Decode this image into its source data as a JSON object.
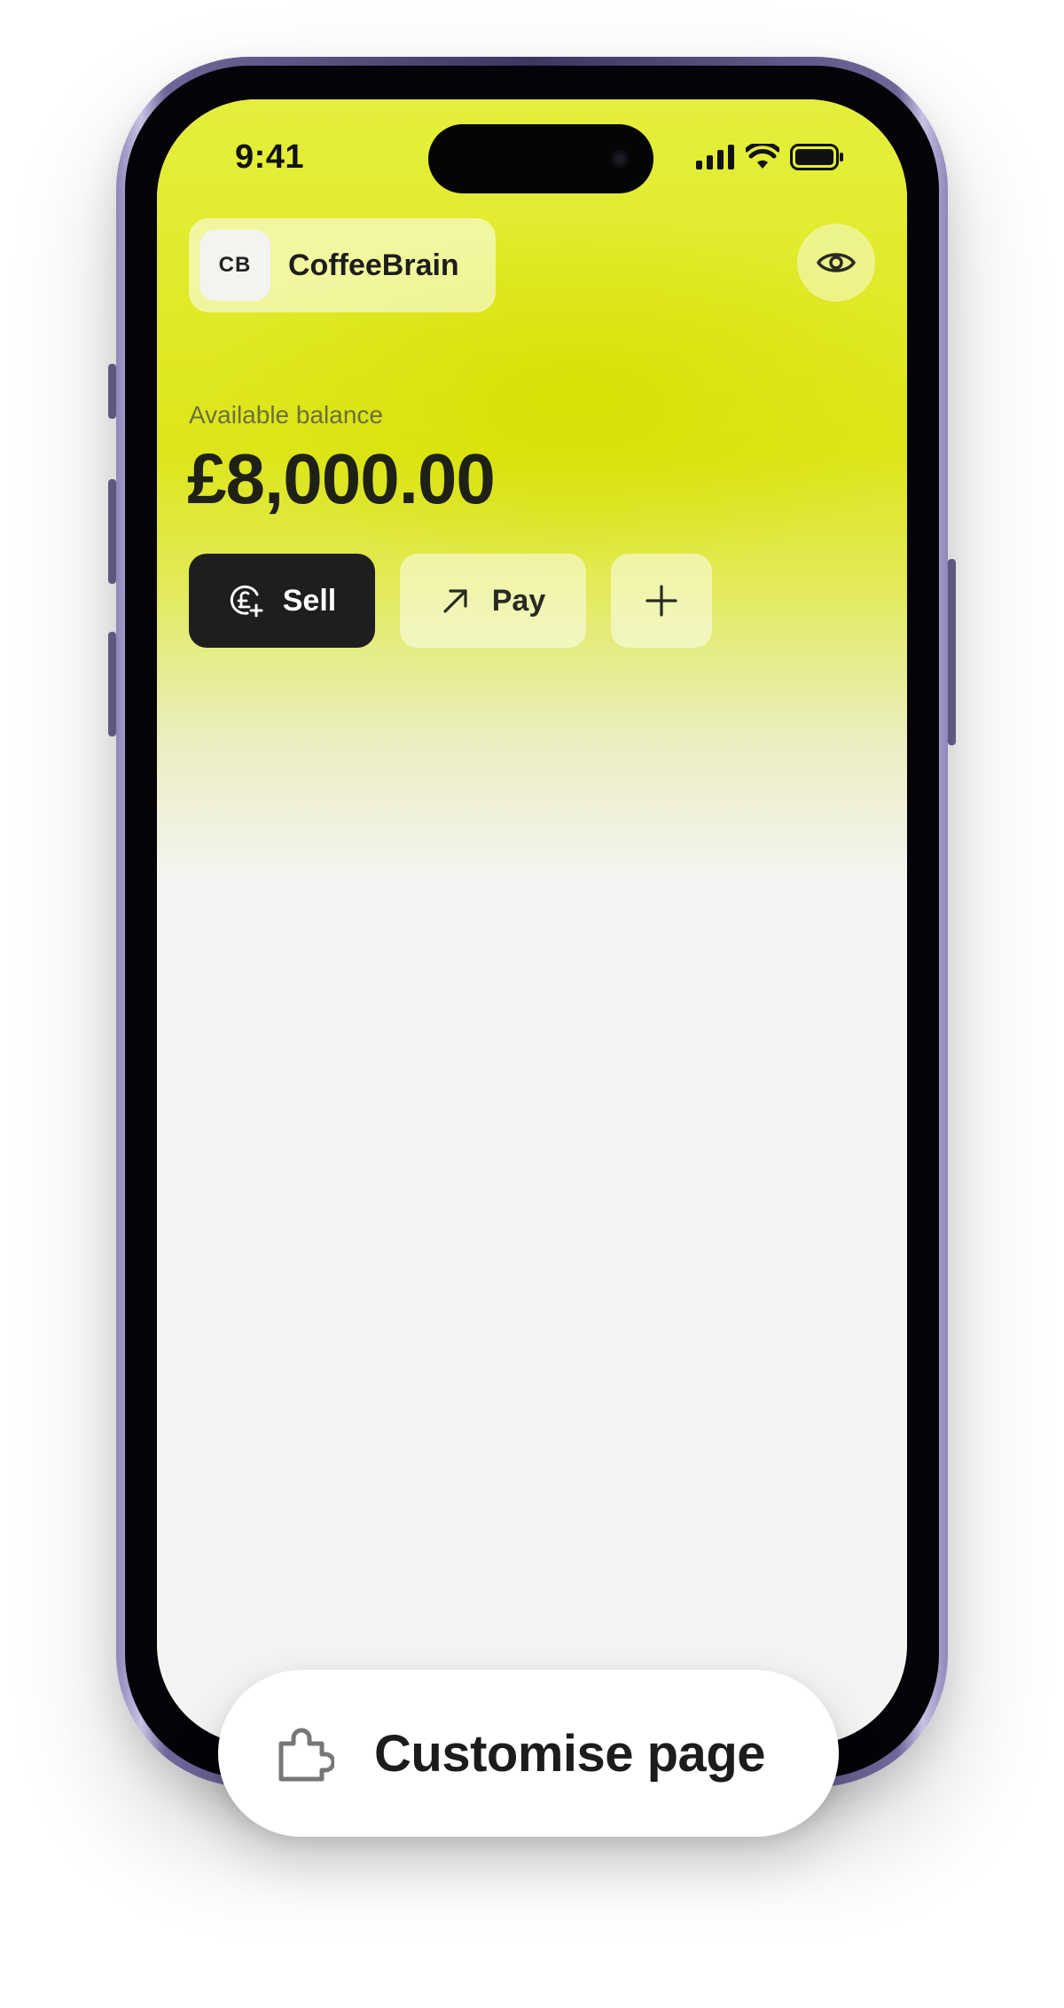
{
  "status_bar": {
    "time": "9:41",
    "icons": [
      "signal-icon",
      "wifi-icon",
      "battery-icon"
    ]
  },
  "header": {
    "account_initials": "CB",
    "account_name": "CoffeeBrain",
    "visibility_icon": "eye-icon"
  },
  "balance": {
    "label": "Available balance",
    "value": "£8,000.00"
  },
  "actions": {
    "sell_label": "Sell",
    "sell_icon": "pound-plus-icon",
    "pay_label": "Pay",
    "pay_icon": "arrow-up-right-icon",
    "add_label": "+",
    "add_icon": "plus-icon"
  },
  "floating_action": {
    "label": "Customise page",
    "icon": "puzzle-icon"
  },
  "colors": {
    "accent": "#dde61a",
    "sell_button": "#1e1e1e",
    "screen_background": "#f5f4f2"
  }
}
